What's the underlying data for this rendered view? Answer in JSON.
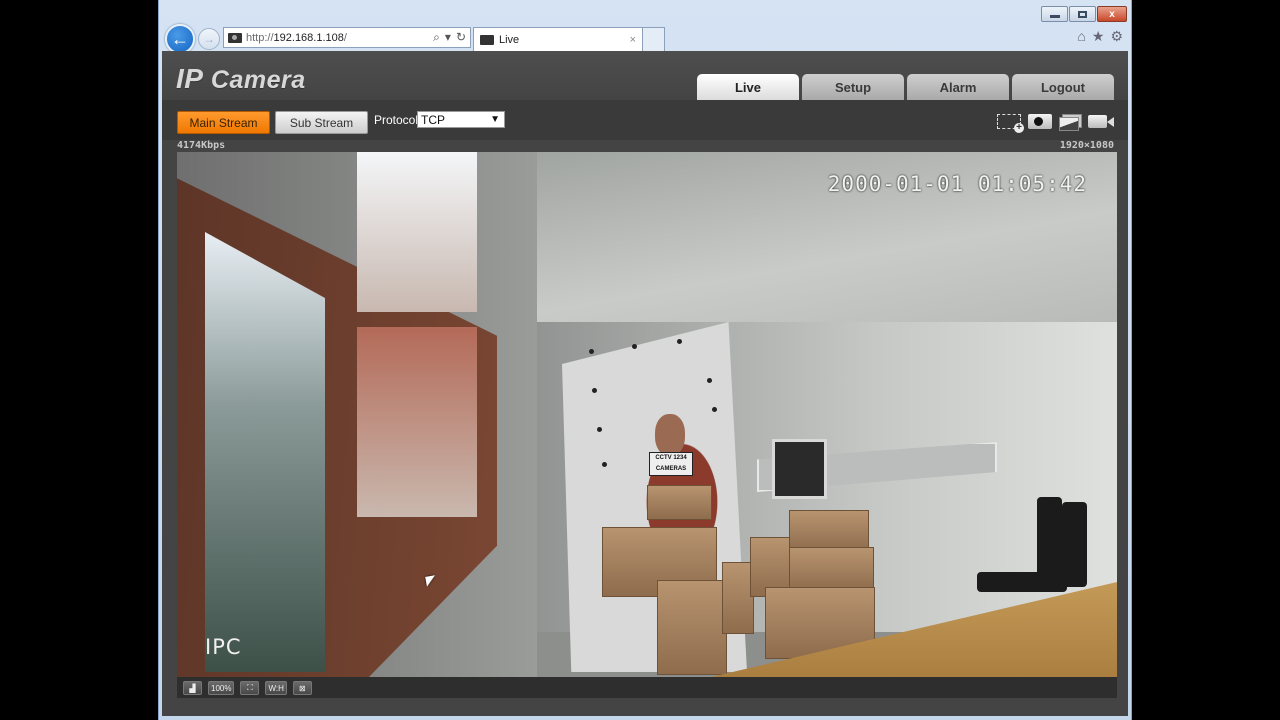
{
  "browser": {
    "url_scheme": "http://",
    "url_host": "192.168.1.108",
    "url_suffix": "/",
    "tab_title": "Live",
    "tab_close": "×",
    "back_icon": "←",
    "forward_icon": "→",
    "search_icon": "⌕",
    "dropdown_icon": "▾",
    "refresh_icon": "↻",
    "home_icon": "⌂",
    "favorites_icon": "★",
    "settings_icon": "⚙",
    "window_close": "x"
  },
  "app": {
    "logo_ip": "IP",
    "logo_rest": " Camera",
    "tabs": [
      {
        "label": "Live",
        "active": true
      },
      {
        "label": "Setup",
        "active": false
      },
      {
        "label": "Alarm",
        "active": false
      },
      {
        "label": "Logout",
        "active": false
      }
    ],
    "toolbar": {
      "main_stream": "Main Stream",
      "sub_stream": "Sub Stream",
      "protocol_label": "Protocol",
      "protocol_value": "TCP",
      "protocol_chevron": "⌄",
      "video_tool_icons": [
        "zoom-region-icon",
        "snapshot-icon",
        "triple-snap-icon",
        "record-icon"
      ]
    },
    "bitrate": "4174Kbps",
    "resolution": "1920×1080",
    "video": {
      "osd_datetime": "2000-01-01 01:05:42",
      "osd_channel": "IPC",
      "sign_line1": "CCTV 1234",
      "sign_line2": "CAMERAS"
    },
    "bottom_controls": [
      {
        "name": "restore-icon",
        "label": "▟"
      },
      {
        "name": "original-size-button",
        "label": "100%"
      },
      {
        "name": "fit-icon",
        "label": "⛶"
      },
      {
        "name": "wh-ratio-button",
        "label": "W:H"
      },
      {
        "name": "fullscreen-icon",
        "label": "⊠"
      }
    ]
  }
}
